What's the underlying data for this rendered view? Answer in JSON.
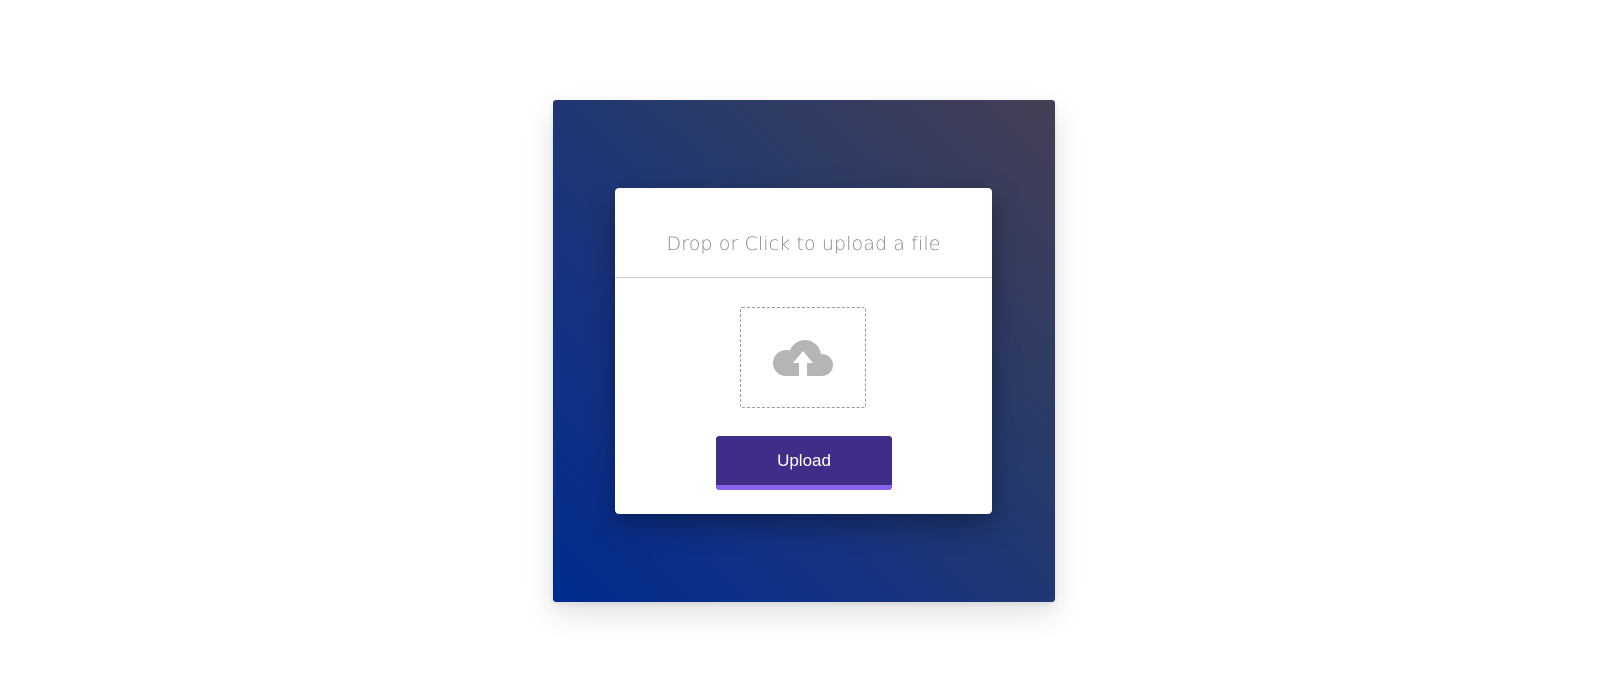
{
  "uploader": {
    "title": "Drop or Click to upload a file",
    "drop_zone_icon": "cloud-upload-icon",
    "button_label": "Upload"
  },
  "colors": {
    "background_gradient": [
      "#002b8f",
      "#453f54"
    ],
    "button": "#3f2d87",
    "button_accent": "#8a63e8",
    "icon": "#b5b5b5",
    "title_text": "#8a8a8a"
  }
}
